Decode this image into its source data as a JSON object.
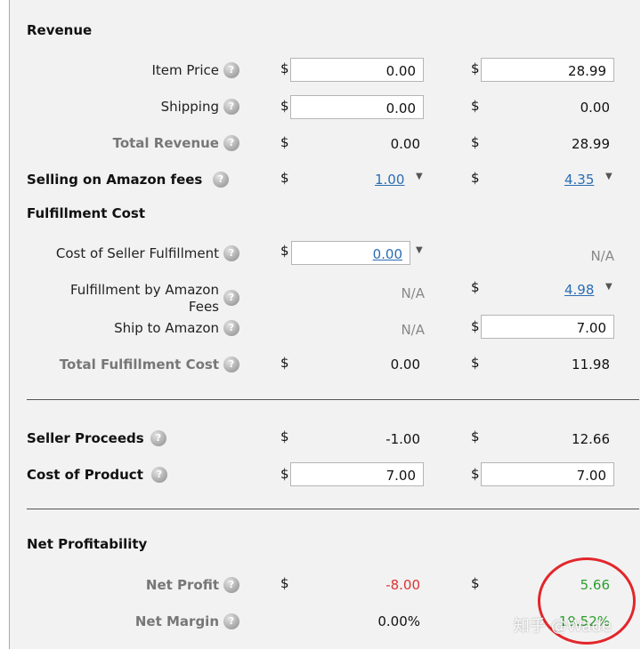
{
  "revenue": {
    "header": "Revenue",
    "item_price": {
      "label": "Item Price",
      "currency_a": "$",
      "value_a": "0.00",
      "currency_b": "$",
      "value_b": "28.99"
    },
    "shipping": {
      "label": "Shipping",
      "currency_a": "$",
      "value_a": "0.00",
      "currency_b": "$",
      "value_b": "0.00"
    },
    "total_revenue": {
      "label": "Total Revenue",
      "currency_a": "$",
      "value_a": "0.00",
      "currency_b": "$",
      "value_b": "28.99"
    }
  },
  "selling_fees": {
    "label": "Selling on Amazon fees",
    "currency_a": "$",
    "value_a": "1.00",
    "currency_b": "$",
    "value_b": "4.35"
  },
  "fulfillment": {
    "header": "Fulfillment Cost",
    "seller_fulfillment": {
      "label": "Cost of Seller Fulfillment",
      "currency_a": "$",
      "value_a": "0.00",
      "value_b": "N/A"
    },
    "fba_fees": {
      "label_line1": "Fulfillment by Amazon",
      "label_line2": "Fees",
      "value_a": "N/A",
      "currency_b": "$",
      "value_b": "4.98"
    },
    "ship_to_amazon": {
      "label": "Ship to Amazon",
      "value_a": "N/A",
      "currency_b": "$",
      "value_b": "7.00"
    },
    "total_fulfillment": {
      "label": "Total Fulfillment Cost",
      "currency_a": "$",
      "value_a": "0.00",
      "currency_b": "$",
      "value_b": "11.98"
    }
  },
  "seller_proceeds": {
    "label": "Seller Proceeds",
    "currency_a": "$",
    "value_a": "-1.00",
    "currency_b": "$",
    "value_b": "12.66"
  },
  "cost_of_product": {
    "label": "Cost of Product",
    "currency_a": "$",
    "value_a": "7.00",
    "currency_b": "$",
    "value_b": "7.00"
  },
  "net_profitability": {
    "header": "Net Profitability",
    "net_profit": {
      "label": "Net Profit",
      "currency_a": "$",
      "value_a": "-8.00",
      "currency_b": "$",
      "value_b": "5.66"
    },
    "net_margin": {
      "label": "Net Margin",
      "value_a": "0.00%",
      "value_b": "19.52%"
    }
  },
  "help_glyph": "?",
  "caret_glyph": "▼",
  "watermark": "知乎 @Wade",
  "colors": {
    "negative": "#dd3333",
    "positive": "#2e9d2e",
    "link": "#2a6db3",
    "annotation_circle": "#e2262b"
  }
}
